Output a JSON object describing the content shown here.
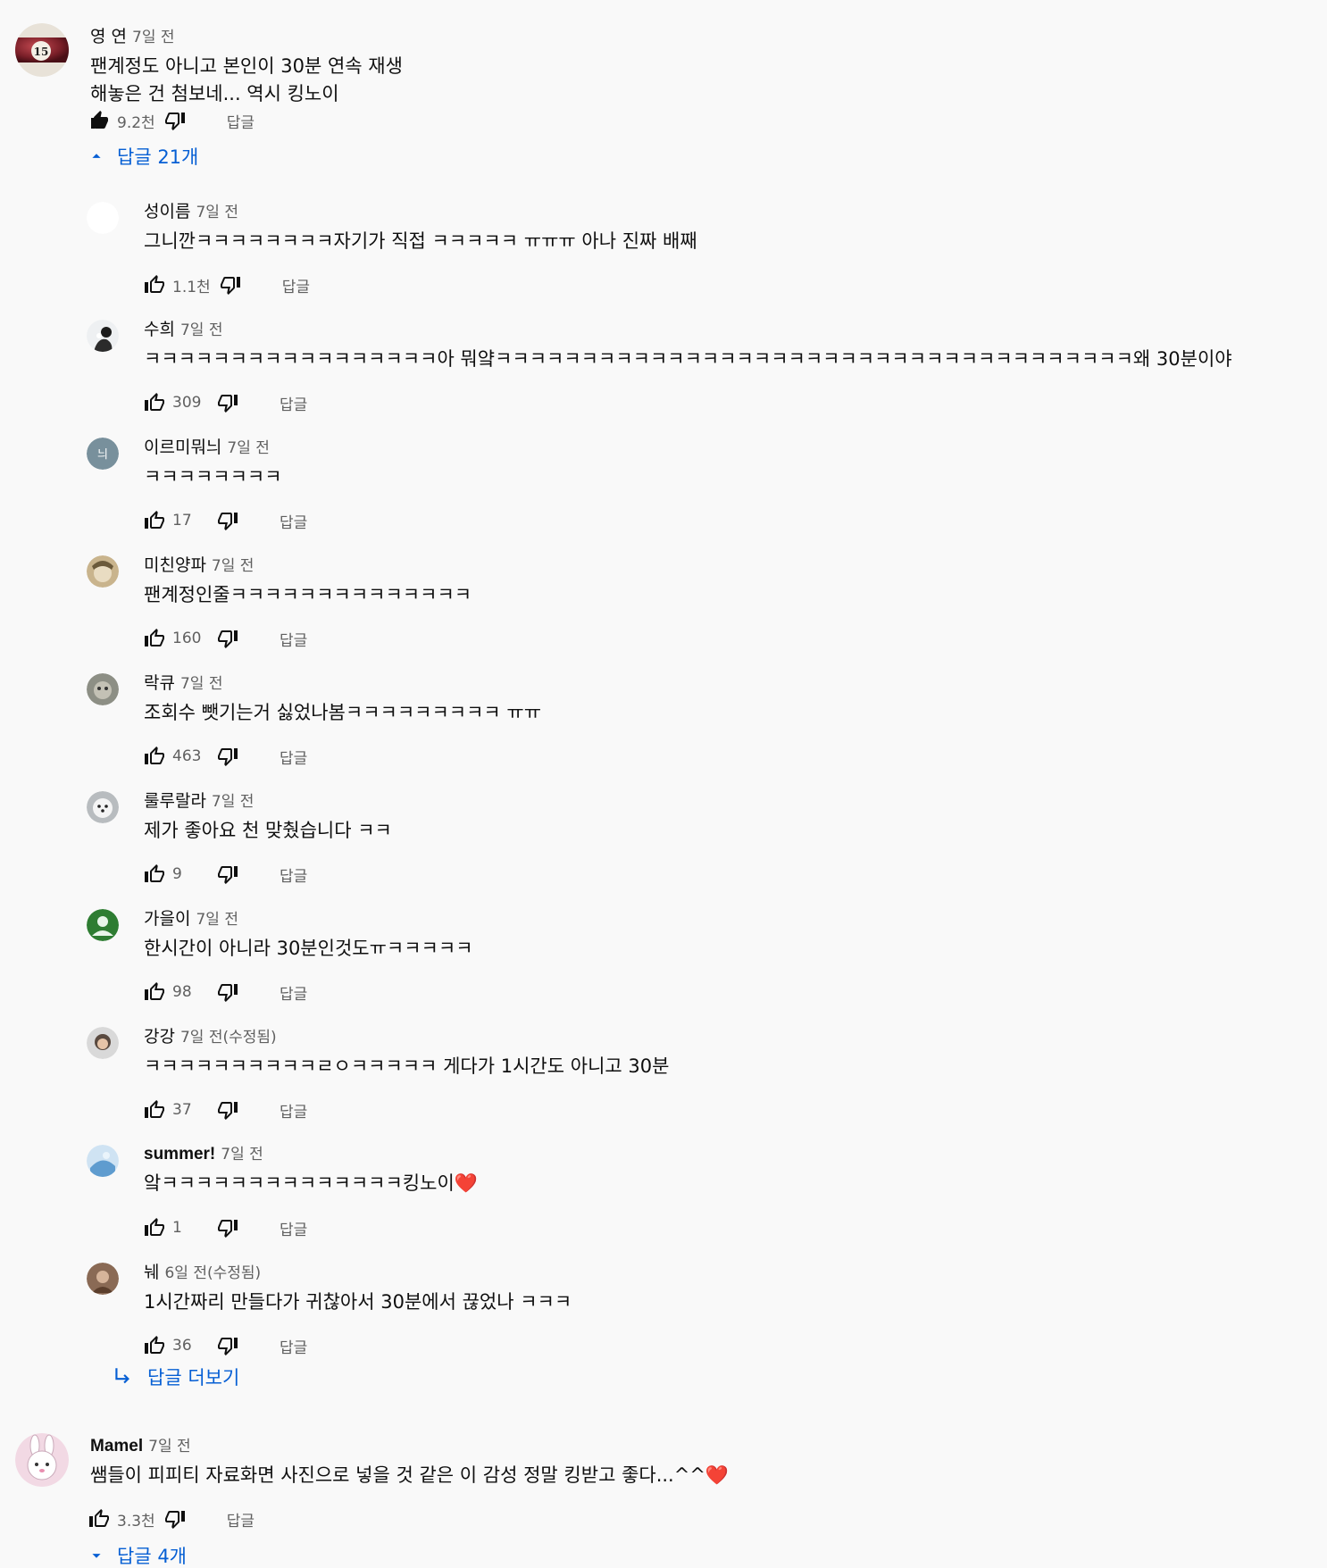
{
  "comment1": {
    "author": "영 연",
    "time": "7일 전",
    "lines": [
      "팬계정도 아니고 본인이 30분 연속 재생",
      "해놓은 건 첨보네... 역시 킹노이"
    ],
    "likes": "9.2천",
    "reply_label": "답글",
    "avatar_badge": "15",
    "replies_toggle": "답글 21개",
    "replies": [
      {
        "author": "성이름",
        "time": "7일 전",
        "text": "그니깐ㅋㅋㅋㅋㅋㅋㅋㅋ자기가 직접 ㅋㅋㅋㅋㅋ ㅠㅠㅠ 아나 진짜 배째",
        "likes": "1.1천",
        "avatar": "blank"
      },
      {
        "author": "수희",
        "time": "7일 전",
        "text": "ㅋㅋㅋㅋㅋㅋㅋㅋㅋㅋㅋㅋㅋㅋㅋㅋㅋ아 뭐얔ㅋㅋㅋㅋㅋㅋㅋㅋㅋㅋㅋㅋㅋㅋㅋㅋㅋㅋㅋㅋㅋㅋㅋㅋㅋㅋㅋㅋㅋㅋㅋㅋㅋㅋㅋㅋㅋ왜 30분이야",
        "likes": "309",
        "avatar": "photo-bw"
      },
      {
        "author": "이르미뭐늬",
        "time": "7일 전",
        "text": "ㅋㅋㅋㅋㅋㅋㅋㅋ",
        "likes": "17",
        "avatar": "letter",
        "avatar_letter": "늬"
      },
      {
        "author": "미친양파",
        "time": "7일 전",
        "text": "팬계정인줄ㅋㅋㅋㅋㅋㅋㅋㅋㅋㅋㅋㅋㅋㅋ",
        "likes": "160",
        "avatar": "photo-tan"
      },
      {
        "author": "락큐",
        "time": "7일 전",
        "text": "조회수 뺏기는거 싫었나봄ㅋㅋㅋㅋㅋㅋㅋㅋㅋ ㅠㅠ",
        "likes": "463",
        "avatar": "photo-gray"
      },
      {
        "author": "룰루랄라",
        "time": "7일 전",
        "text": "제가 좋아요 천 맞췄습니다 ㅋㅋ",
        "likes": "9",
        "avatar": "photo-dog"
      },
      {
        "author": "가을이",
        "time": "7일 전",
        "text": "한시간이 아니라 30분인것도ㅠㅋㅋㅋㅋㅋ",
        "likes": "98",
        "avatar": "default-green"
      },
      {
        "author": "강강",
        "time": "7일 전(수정됨)",
        "text": "ㅋㅋㅋㅋㅋㅋㅋㅋㅋㅋㄹㅇㅋㅋㅋㅋㅋ 게다가 1시간도 아니고 30분",
        "likes": "37",
        "avatar": "photo-face"
      },
      {
        "author": "summer!",
        "time": "7일 전",
        "text": "앜ㅋㅋㅋㅋㅋㅋㅋㅋㅋㅋㅋㅋㅋㅋ킹노이❤️",
        "likes": "1",
        "avatar": "photo-blue",
        "bold_author": true
      },
      {
        "author": "눼",
        "time": "6일 전(수정됨)",
        "text": "1시간짜리 만들다가 귀찮아서 30분에서 끊었나 ㅋㅋㅋ",
        "likes": "36",
        "avatar": "photo-brown"
      }
    ],
    "more_replies": "답글 더보기"
  },
  "comment2": {
    "author": "Mamel",
    "time": "7일 전",
    "lines": [
      "쌤들이 피피티 자료화면 사진으로 넣을 것 같은 이 감성 정말 킹받고 좋다...^^❤️"
    ],
    "likes": "3.3천",
    "reply_label": "답글",
    "replies_toggle": "답글 4개"
  },
  "colors": {
    "link": "#065fd4",
    "meta": "#606060",
    "text": "#0f0f0f",
    "background": "#f9f9f9"
  }
}
